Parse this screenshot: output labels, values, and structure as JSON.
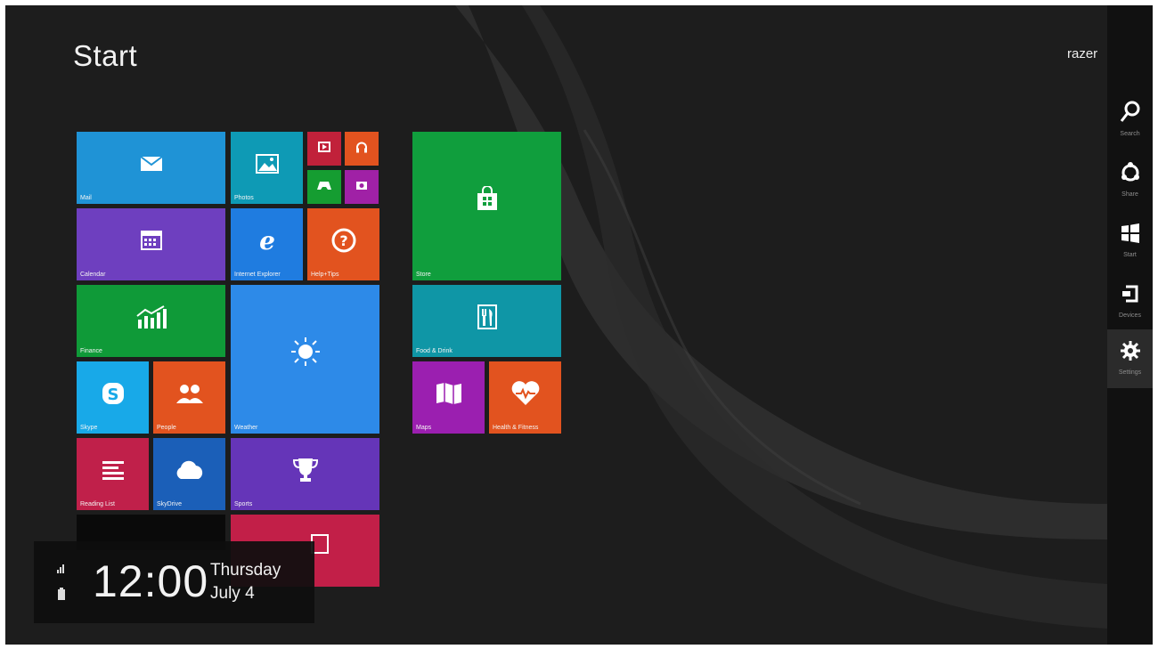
{
  "start": {
    "title": "Start",
    "user_name": "razer"
  },
  "tiles": {
    "mail": "Mail",
    "photos": "Photos",
    "calendar": "Calendar",
    "internet_explorer": "Internet Explorer",
    "help_tips": "Help+Tips",
    "finance": "Finance",
    "weather": "Weather",
    "skype": "Skype",
    "people": "People",
    "reading_list": "Reading List",
    "skydrive": "SkyDrive",
    "sports": "Sports",
    "store": "Store",
    "food_drink": "Food & Drink",
    "maps": "Maps",
    "health_fitness": "Health & Fitness"
  },
  "tile_colors": {
    "mail": "#1f93d6",
    "photos": "#0e9ab5",
    "video": "#c1213a",
    "music": "#e2531f",
    "games": "#159d31",
    "camera": "#a021a6",
    "calendar": "#6e3fbf",
    "internet_explorer": "#1f7ce0",
    "help_tips": "#e2531f",
    "finance": "#0f9a38",
    "weather": "#2d8ae8",
    "skype": "#18a9e8",
    "people": "#e2531f",
    "reading_list": "#c0204a",
    "skydrive": "#1b5fb8",
    "sports": "#6535b8",
    "store": "#109e3d",
    "food_drink": "#0f96a6",
    "maps": "#9b1fb0",
    "health_fitness": "#e2531f",
    "desktop": "#0a0a0a",
    "news": "#c21f48"
  },
  "charms": [
    {
      "label": "Search",
      "icon": "search-icon"
    },
    {
      "label": "Share",
      "icon": "share-icon"
    },
    {
      "label": "Start",
      "icon": "windows-logo-icon"
    },
    {
      "label": "Devices",
      "icon": "devices-icon"
    },
    {
      "label": "Settings",
      "icon": "gear-icon"
    }
  ],
  "clock": {
    "time": "12:00",
    "day": "Thursday",
    "date": "July 4"
  }
}
